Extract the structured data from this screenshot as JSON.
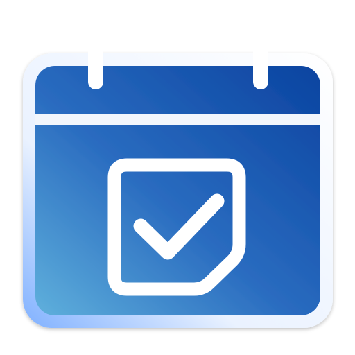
{
  "icon": {
    "name": "calendar-check-icon",
    "colors": {
      "gradient_top_right": "#0a43a0",
      "gradient_mid": "#2a6cc0",
      "gradient_bottom_left": "#5fb0dc",
      "frame": "#ffffff",
      "frame_glow": "#7fb0ff",
      "background": "#ffffff"
    }
  }
}
